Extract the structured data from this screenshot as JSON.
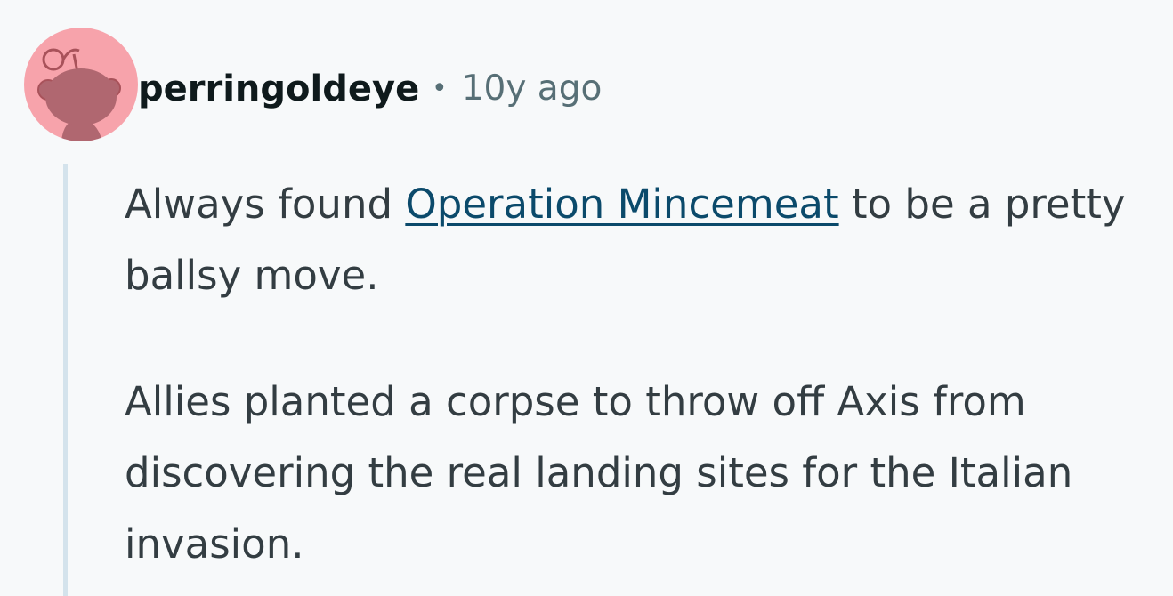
{
  "comment": {
    "author": "perringoldeye",
    "separator": "•",
    "timestamp": "10y ago",
    "avatar_icon": "snoo-avatar-icon",
    "avatar_color": "#f7a3ab",
    "paragraph_1": {
      "before_link": "Always found ",
      "link_text": "Operation Mincemeat",
      "after_link": " to be a pretty ballsy move."
    },
    "paragraph_2": "Allies planted a corpse to throw off Axis from discovering the real landing sites for the Italian invasion."
  }
}
